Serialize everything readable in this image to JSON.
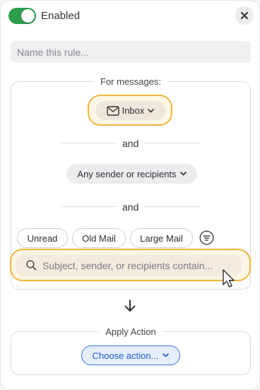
{
  "header": {
    "toggle_on": true,
    "enabled_label": "Enabled",
    "close_icon": "close-icon"
  },
  "rule_name": {
    "value": "",
    "placeholder": "Name this rule..."
  },
  "conditions": {
    "legend": "For messages:",
    "mailbox_label": "Inbox",
    "mailbox_icon": "envelope-icon",
    "and_1": "and",
    "sender_label": "Any sender or recipients",
    "and_2": "and",
    "filters": [
      "Unread",
      "Old Mail",
      "Large Mail"
    ],
    "filter_icon": "filter-lines-icon",
    "search_placeholder": "Subject, sender, or recipients contain...",
    "search_value": ""
  },
  "action": {
    "legend": "Apply Action",
    "choose_label": "Choose action..."
  },
  "colors": {
    "toggle_green": "#2e9d4f",
    "highlight": "#f0b53a",
    "accent_blue": "#3a73e0"
  }
}
